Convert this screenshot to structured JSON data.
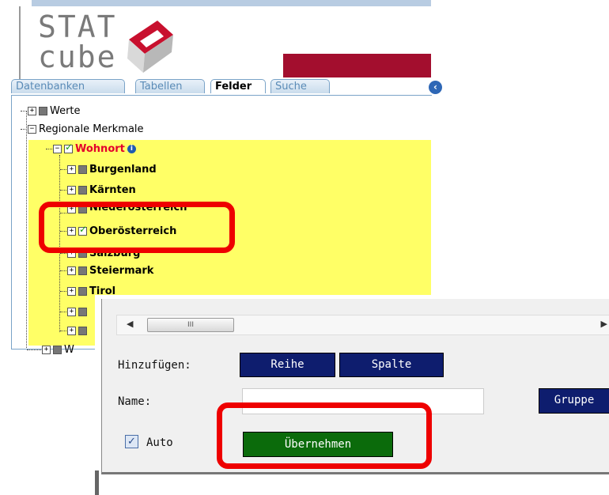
{
  "logo": {
    "line1": "STAT",
    "line2": "cube"
  },
  "tabs": [
    {
      "label": "Datenbanken",
      "active": false
    },
    {
      "label": "Tabellen",
      "active": false
    },
    {
      "label": "Felder",
      "active": true
    },
    {
      "label": "Suche",
      "active": false
    }
  ],
  "tree": {
    "werte": "Werte",
    "regional": "Regionale Merkmale",
    "wohnort": "Wohnort",
    "items": [
      {
        "label": "Burgenland",
        "checked": false
      },
      {
        "label": "Kärnten",
        "checked": false
      },
      {
        "label": "Niederösterreich",
        "checked": false
      },
      {
        "label": "Oberösterreich",
        "checked": true
      },
      {
        "label": "Salzburg",
        "checked": false
      },
      {
        "label": "Steiermark",
        "checked": false
      },
      {
        "label": "Tirol",
        "checked": false
      }
    ],
    "last_partial": "W"
  },
  "panel": {
    "add_label": "Hinzufügen:",
    "row_button": "Reihe",
    "column_button": "Spalte",
    "name_label": "Name:",
    "name_value": "",
    "group_button": "Gruppe",
    "auto_label": "Auto",
    "auto_checked": true,
    "apply_button": "Übernehmen"
  },
  "colors": {
    "highlight": "#ee0000",
    "apply_green": "#0b6b0b",
    "navy": "#0e1d6e",
    "tree_yellow": "#ffff66",
    "brand_red": "#a30e2e"
  }
}
